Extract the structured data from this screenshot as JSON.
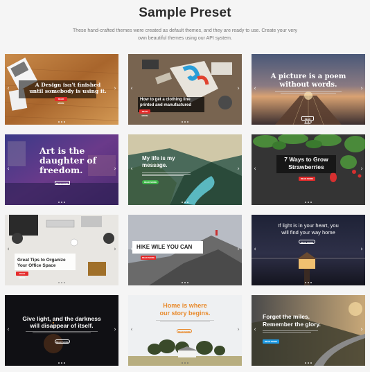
{
  "header": {
    "title": "Sample Preset",
    "description": "These hand-crafted themes were created as default themes, and they are ready to use. Create your very own beautiful themes using our API system."
  },
  "cards": [
    {
      "heading_l1": "A Design isn't finished",
      "heading_l2": "until somebody is using it.",
      "button": "READ MORE"
    },
    {
      "heading_l1": "How to get a clothing line",
      "heading_l2": "printed and manufactured",
      "button": "READ MORE"
    },
    {
      "heading_l1": "A picture is a poem",
      "heading_l2": "without words.",
      "button": "READ MORE"
    },
    {
      "heading_l1": "Art is the",
      "heading_l2": "daughter of",
      "heading_l3": "freedom.",
      "button": "READ MORE"
    },
    {
      "heading_l1": "My life is my",
      "heading_l2": "message.",
      "button": "READ MORE"
    },
    {
      "heading_l1": "7 Ways to Grow",
      "heading_l2": "Strawberries",
      "button": "READ MORE"
    },
    {
      "heading_l1": "Great Tips to Organize",
      "heading_l2": "Your Office Space",
      "button": "READ MORE"
    },
    {
      "heading_l1": "HIKE WILE YOU CAN",
      "button": "READ MORE"
    },
    {
      "heading_l1": "If light is in your heart, you",
      "heading_l2": "will find your way home",
      "button": "READ MORE"
    },
    {
      "heading_l1": "Give light, and the darkness",
      "heading_l2": "will disappear of itself.",
      "button": "READ MORE"
    },
    {
      "heading_l1": "Home is where",
      "heading_l2": "our story begins.",
      "button": "READ MORE"
    },
    {
      "heading_l1": "Forget the miles.",
      "heading_l2": "Remember the glory.",
      "button": "READ MORE"
    }
  ],
  "icons": {
    "prev": "chevron-left-icon",
    "next": "chevron-right-icon",
    "dots": "pagination-dots"
  },
  "colors": {
    "red": "#e52b2b",
    "green": "#3fb54a",
    "blue": "#1e9be6",
    "orange": "#e88a2c"
  }
}
